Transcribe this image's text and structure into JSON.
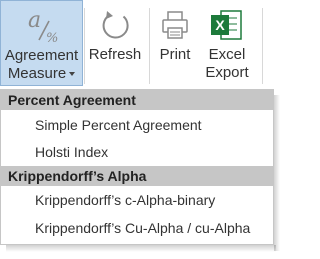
{
  "ribbon": {
    "buttons": [
      {
        "label_line1": "Agreement",
        "label_line2": "Measure",
        "icon": "agreement-measure-icon",
        "icon_text": "a/%",
        "dropdown": true,
        "active": true
      },
      {
        "label_line1": "Refresh",
        "label_line2": "",
        "icon": "refresh-icon"
      },
      {
        "label_line1": "Print",
        "label_line2": "",
        "icon": "printer-icon"
      },
      {
        "label_line1": "Excel",
        "label_line2": "Export",
        "icon": "excel-icon",
        "icon_text": "X"
      }
    ]
  },
  "menu": {
    "sections": [
      {
        "header": "Percent Agreement",
        "items": [
          "Simple Percent Agreement",
          "Holsti Index"
        ]
      },
      {
        "header": "Krippendorff’s Alpha",
        "items": [
          "Krippendorff’s c-Alpha-binary",
          "Krippendorff’s Cu-Alpha / cu-Alpha"
        ]
      }
    ]
  },
  "colors": {
    "active_button_bg": "#c5dbf0",
    "active_button_border": "#90b3d6",
    "section_header_bg": "#c6c6c6",
    "excel_green": "#1d7a3b"
  }
}
